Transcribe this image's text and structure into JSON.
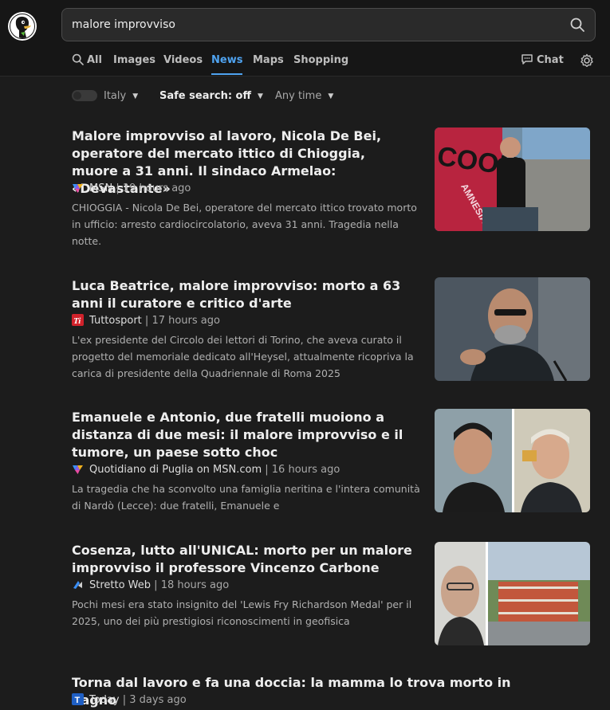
{
  "search": {
    "query": "malore improvviso"
  },
  "tabs": [
    {
      "label": "All",
      "icon": "search-icon"
    },
    {
      "label": "Images"
    },
    {
      "label": "Videos"
    },
    {
      "label": "News",
      "active": true
    },
    {
      "label": "Maps"
    },
    {
      "label": "Shopping"
    }
  ],
  "chat_label": "Chat",
  "filters": {
    "region": "Italy",
    "safe_search": "Safe search: off",
    "time": "Any time"
  },
  "results": [
    {
      "title": "Malore improvviso al lavoro, Nicola De Bei, operatore del mercato ittico di Chioggia, muore a 31 anni. Il sindaco Armelao: «Devastante»",
      "source": "MSN",
      "time": "19 hours ago",
      "snippet": "CHIOGGIA - Nicola De Bei, operatore del mercato ittico trovato morto in ufficio: arresto cardiocircolatorio, aveva 31 anni. Tragedia nella notte.",
      "thumb_text": "COON · AMNESIA"
    },
    {
      "title": "Luca Beatrice, malore improvviso: morto a 63 anni il curatore e critico d'arte",
      "source": "Tuttosport",
      "time": "17 hours ago",
      "snippet": "L'ex presidente del Circolo dei lettori di Torino, che aveva curato il progetto del memoriale dedicato all'Heysel, attualmente ricopriva la carica di presidente della Quadriennale di Roma 2025"
    },
    {
      "title": "Emanuele e Antonio, due fratelli muoiono a distanza di due mesi: il malore improvviso e il tumore, un paese sotto choc",
      "source": "Quotidiano di Puglia on MSN.com",
      "time": "16 hours ago",
      "snippet": "La tragedia che ha sconvolto una famiglia neritina e l'intera comunità di Nardò (Lecce): due fratelli, Emanuele e"
    },
    {
      "title": "Cosenza, lutto all'UNICAL: morto per un malore improvviso il professore Vincenzo Carbone",
      "source": "Stretto Web",
      "time": "18 hours ago",
      "snippet": "Pochi mesi era stato insignito del 'Lewis Fry Richardson Medal' per il 2025, uno dei più prestigiosi riconoscimenti in geofisica"
    },
    {
      "title": "Torna dal lavoro e fa una doccia: la mamma lo trova morto in bagno",
      "source": "Today",
      "time": "3 days ago"
    }
  ],
  "colors": {
    "accent": "#4fa3f0",
    "background": "#1c1c1c",
    "header": "#161616"
  }
}
